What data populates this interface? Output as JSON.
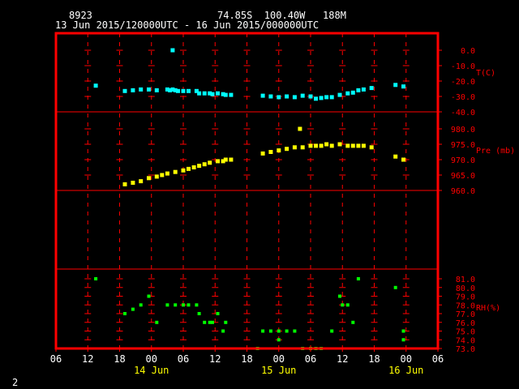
{
  "header": {
    "station": "8923",
    "location": "74.85S  100.40W   188M",
    "time_range": "13 Jun 2015/120000UTC - 16 Jun 2015/000000UTC"
  },
  "footer": {
    "page_number": "2"
  },
  "colors": {
    "frame": "#ff0000",
    "temperature": "#00ffff",
    "pressure": "#ffff00",
    "humidity": "#00ff00",
    "header_text": "#ffffff",
    "date_text": "#ffff00"
  },
  "chart_data": {
    "type": "scatter",
    "x_axis": {
      "units": "hours since 13 Jun 2015 06:00 UTC",
      "range": [
        0,
        72
      ],
      "tick_values": [
        0,
        6,
        12,
        18,
        24,
        30,
        36,
        42,
        48,
        54,
        60,
        66,
        72
      ],
      "tick_labels": [
        "06",
        "12",
        "18",
        "00",
        "06",
        "12",
        "18",
        "00",
        "06",
        "12",
        "18",
        "00",
        "06"
      ],
      "date_labels": [
        {
          "x": 18,
          "label": "14 Jun"
        },
        {
          "x": 42,
          "label": "15 Jun"
        },
        {
          "x": 66,
          "label": "16 Jun"
        }
      ]
    },
    "panels": [
      {
        "name": "temperature",
        "label": "T(C)",
        "y_range": [
          -40,
          10
        ],
        "y_ticks": [
          0,
          -10,
          -20,
          -30,
          -40
        ],
        "y_tick_labels": [
          "0.0",
          "-10.0",
          "-20.0",
          "-30.0",
          "-40.0"
        ],
        "points": [
          [
            7.5,
            -23
          ],
          [
            13,
            -26.5
          ],
          [
            14.5,
            -26
          ],
          [
            16,
            -25.5
          ],
          [
            17.5,
            -25.5
          ],
          [
            19,
            -26
          ],
          [
            21,
            -25.5
          ],
          [
            21.5,
            -26
          ],
          [
            22,
            -25.5
          ],
          [
            22.5,
            -26
          ],
          [
            23,
            -26.5
          ],
          [
            24,
            -26.5
          ],
          [
            25,
            -26.5
          ],
          [
            26.5,
            -26.5
          ],
          [
            27,
            -28
          ],
          [
            28,
            -28
          ],
          [
            29,
            -28
          ],
          [
            29.5,
            -28.5
          ],
          [
            30.5,
            -28
          ],
          [
            31.5,
            -28.5
          ],
          [
            32,
            -29
          ],
          [
            33,
            -29
          ],
          [
            39,
            -29.5
          ],
          [
            40.5,
            -30
          ],
          [
            42,
            -30.5
          ],
          [
            43.5,
            -30
          ],
          [
            45,
            -30.5
          ],
          [
            46.5,
            -29.5
          ],
          [
            48,
            -30
          ],
          [
            49,
            -31.5
          ],
          [
            50,
            -31
          ],
          [
            51,
            -30.5
          ],
          [
            52,
            -30.5
          ],
          [
            53.5,
            -29
          ],
          [
            55,
            -28
          ],
          [
            56,
            -27.5
          ],
          [
            57,
            -26
          ],
          [
            58,
            -25.5
          ],
          [
            59.5,
            -24.5
          ],
          [
            64,
            -22.5
          ],
          [
            65.5,
            -23.5
          ],
          [
            22,
            0
          ]
        ]
      },
      {
        "name": "pressure",
        "label": "Pre (mb)",
        "y_range": [
          955,
          985
        ],
        "y_ticks": [
          980,
          975,
          970,
          965,
          960
        ],
        "y_tick_labels": [
          "980.0",
          "975.0",
          "970.0",
          "965.0",
          "960.0"
        ],
        "points": [
          [
            13,
            962
          ],
          [
            14.5,
            962.5
          ],
          [
            16,
            963
          ],
          [
            17.5,
            964
          ],
          [
            19,
            964.5
          ],
          [
            20,
            965
          ],
          [
            21,
            965.5
          ],
          [
            22.5,
            966
          ],
          [
            24,
            966.5
          ],
          [
            25,
            967
          ],
          [
            26,
            967.5
          ],
          [
            27,
            968
          ],
          [
            28,
            968.5
          ],
          [
            29,
            969
          ],
          [
            30.5,
            969.5
          ],
          [
            31.5,
            969.5
          ],
          [
            32,
            970
          ],
          [
            33,
            970
          ],
          [
            39,
            972
          ],
          [
            40.5,
            972.5
          ],
          [
            42,
            973
          ],
          [
            43.5,
            973.5
          ],
          [
            45,
            974
          ],
          [
            46.5,
            974
          ],
          [
            48,
            974.5
          ],
          [
            49,
            974.5
          ],
          [
            50,
            974.5
          ],
          [
            51,
            975
          ],
          [
            52,
            974.5
          ],
          [
            53.5,
            975
          ],
          [
            55,
            974.5
          ],
          [
            56,
            974.5
          ],
          [
            57,
            974.5
          ],
          [
            58,
            974.5
          ],
          [
            59.5,
            974
          ],
          [
            64,
            971
          ],
          [
            65.5,
            970
          ],
          [
            46,
            980
          ]
        ]
      },
      {
        "name": "humidity",
        "label": "RH(%)",
        "y_range": [
          73,
          82
        ],
        "y_ticks": [
          81,
          80,
          79,
          78,
          77,
          76,
          75,
          74,
          73
        ],
        "y_tick_labels": [
          "81.0",
          "80.0",
          "79.0",
          "78.0",
          "77.0",
          "76.0",
          "75.0",
          "74.0",
          "73.0"
        ],
        "points": [
          [
            7.5,
            81
          ],
          [
            13,
            77
          ],
          [
            14.5,
            77.5
          ],
          [
            16,
            78
          ],
          [
            17.5,
            79
          ],
          [
            19,
            76
          ],
          [
            21,
            78
          ],
          [
            22.5,
            78
          ],
          [
            24,
            78
          ],
          [
            25,
            78
          ],
          [
            26.5,
            78
          ],
          [
            27,
            77
          ],
          [
            28,
            76
          ],
          [
            29,
            76
          ],
          [
            29.5,
            76
          ],
          [
            30.5,
            77
          ],
          [
            31.5,
            75
          ],
          [
            32,
            76
          ],
          [
            39,
            75
          ],
          [
            40.5,
            75
          ],
          [
            42,
            75
          ],
          [
            42,
            74
          ],
          [
            43.5,
            75
          ],
          [
            45,
            75
          ],
          [
            46.5,
            73
          ],
          [
            48,
            73
          ],
          [
            49,
            73
          ],
          [
            50,
            73
          ],
          [
            52,
            75
          ],
          [
            53.5,
            79
          ],
          [
            54,
            78
          ],
          [
            55,
            78
          ],
          [
            56,
            76
          ],
          [
            57,
            81
          ],
          [
            64,
            80
          ],
          [
            65.5,
            75
          ],
          [
            65.5,
            74
          ],
          [
            38,
            73
          ]
        ]
      }
    ]
  }
}
